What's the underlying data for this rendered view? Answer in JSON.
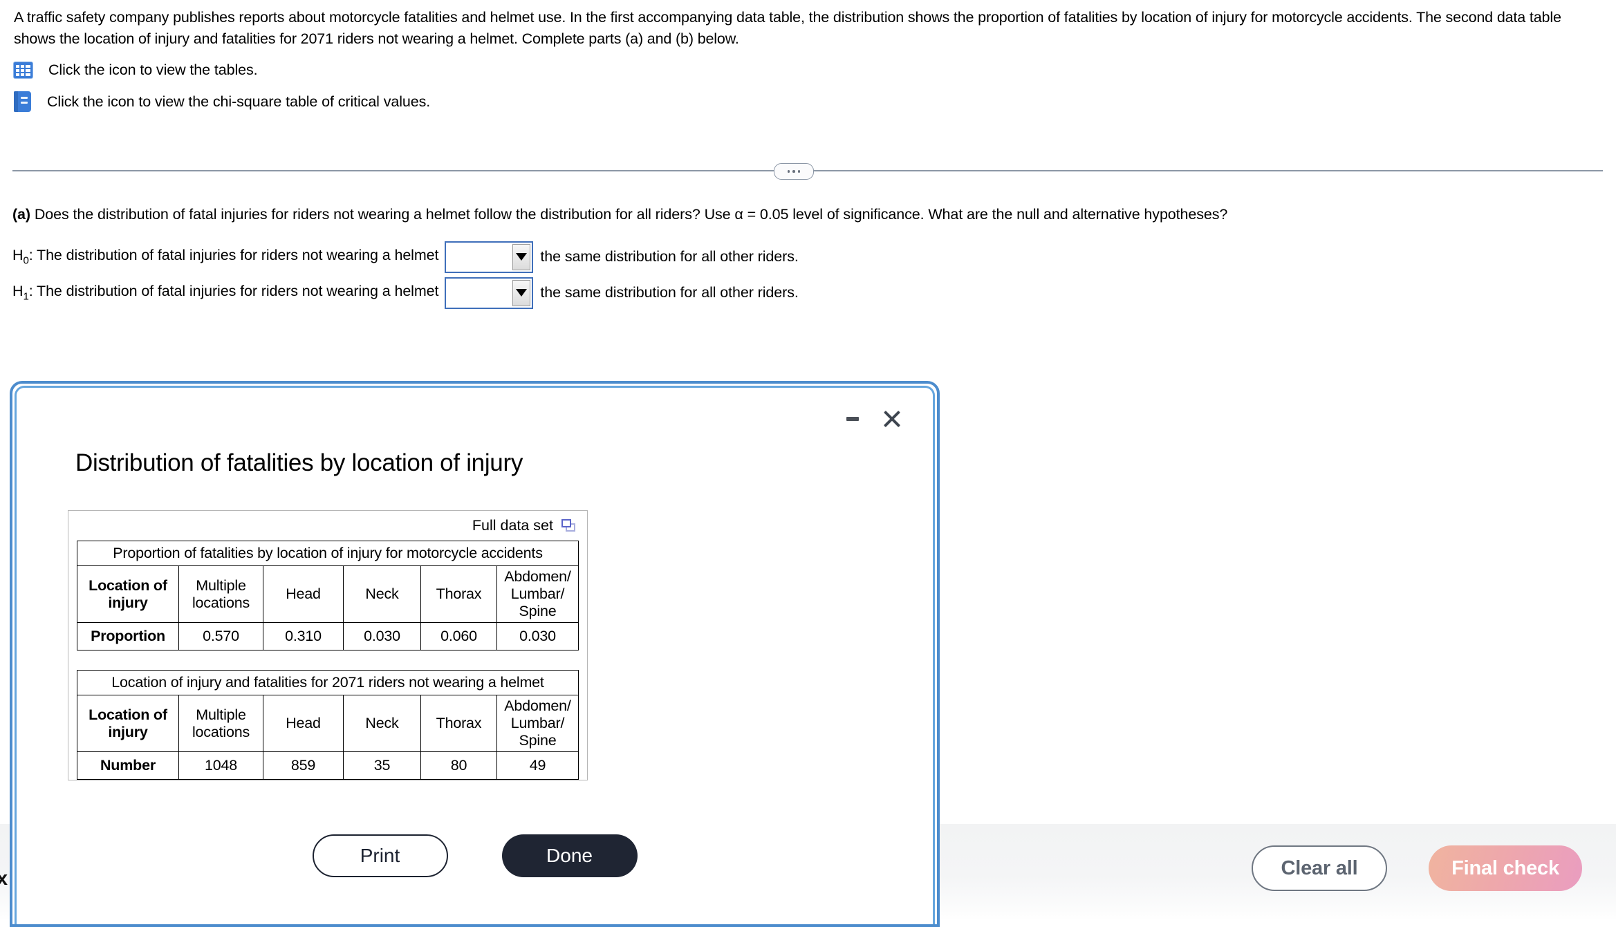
{
  "problem": {
    "statement": "A traffic safety company publishes reports about motorcycle fatalities and helmet use. In the first accompanying data table, the distribution shows the proportion of fatalities by location of injury for motorcycle accidents. The second data table shows the location of injury and fatalities for 2071 riders not wearing a helmet. Complete parts (a) and (b) below.",
    "links": [
      {
        "icon": "table-grid-icon",
        "label": "Click the icon to view the tables."
      },
      {
        "icon": "book-icon",
        "label": "Click the icon to view the chi-square table of critical values."
      }
    ]
  },
  "part_a": {
    "question_prefix": "(a)",
    "question": " Does the distribution of fatal injuries for riders not wearing a helmet follow the distribution for all riders? Use α = 0.05 level of significance. What are the null and alternative hypotheses?",
    "hypotheses": [
      {
        "symbol": "H",
        "subscript": "0",
        "lead": ": The distribution of fatal injuries for riders not wearing a helmet",
        "dropdown_value": "",
        "dropdown_placeholder": "",
        "tail": "the same distribution for all other riders."
      },
      {
        "symbol": "H",
        "subscript": "1",
        "lead": ": The distribution of fatal injuries for riders not wearing a helmet",
        "dropdown_value": "",
        "dropdown_placeholder": "",
        "tail": "the same distribution for all other riders."
      }
    ]
  },
  "dialog": {
    "title": "Distribution of fatalities by location of injury",
    "minimize_icon": "minimize-icon",
    "close_icon": "close-icon",
    "full_data_set_label": "Full data set",
    "copy_icon": "copy-icon",
    "print_label": "Print",
    "done_label": "Done"
  },
  "tables": [
    {
      "title": "Proportion of fatalities by location of injury for motorcycle accidents",
      "row_header_label": "Location of injury",
      "columns": [
        "Multiple locations",
        "Head",
        "Neck",
        "Thorax",
        "Abdomen/ Lumbar/ Spine"
      ],
      "value_row_label": "Proportion",
      "values": [
        "0.570",
        "0.310",
        "0.030",
        "0.060",
        "0.030"
      ]
    },
    {
      "title": "Location of injury and fatalities for 2071 riders not wearing a helmet",
      "row_header_label": "Location of injury",
      "columns": [
        "Multiple locations",
        "Head",
        "Neck",
        "Thorax",
        "Abdomen/ Lumbar/ Spine"
      ],
      "value_row_label": "Number",
      "values": [
        "1048",
        "859",
        "35",
        "80",
        "49"
      ]
    }
  ],
  "bottom_bar": {
    "clear_all_label": "Clear all",
    "final_check_label": "Final check",
    "occluded_text": "x"
  },
  "colors": {
    "icon_blue": "#3b7dd8",
    "dropdown_border": "#3f6fba",
    "dialog_border": "#4c8ccd",
    "done_bg": "#1f2533",
    "final_check_gradient_start": "#f0b49f",
    "final_check_gradient_end": "#ea9dc0",
    "divider": "#8c97a6"
  }
}
